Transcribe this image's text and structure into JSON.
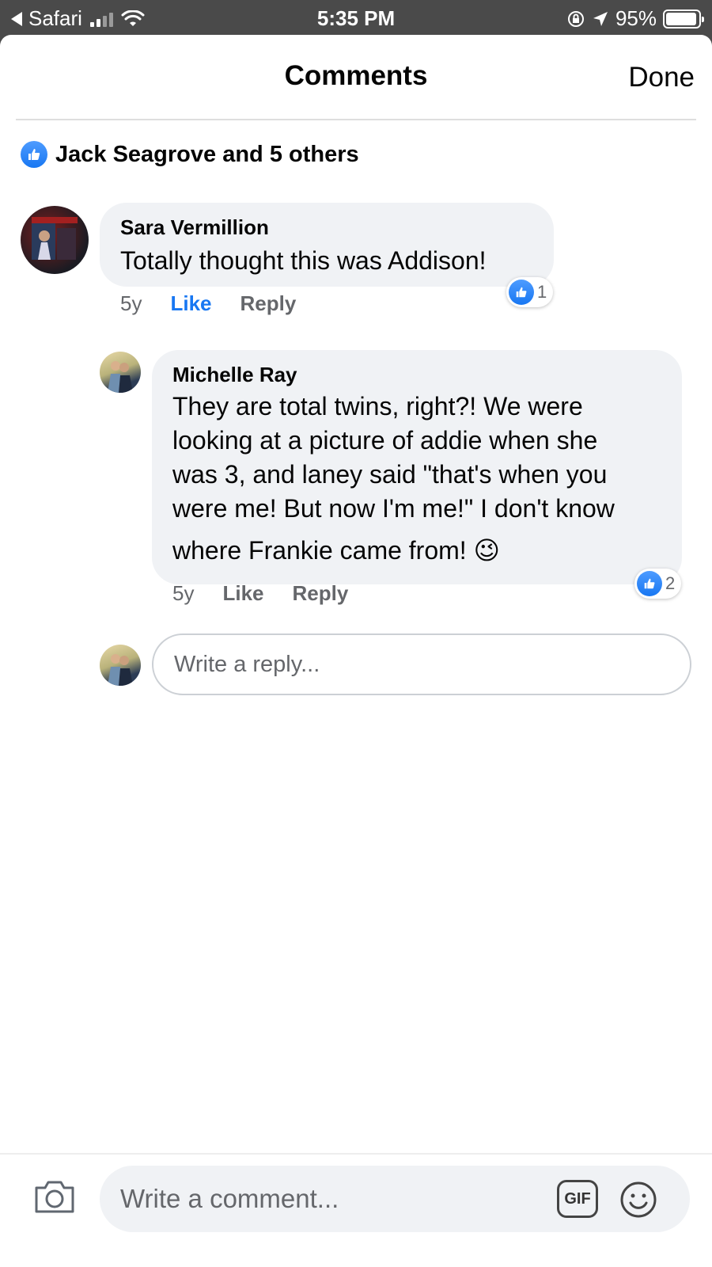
{
  "status_bar": {
    "back_app": "Safari",
    "time": "5:35 PM",
    "battery_percent": "95%",
    "battery_level": 0.95
  },
  "header": {
    "title": "Comments",
    "done_label": "Done"
  },
  "likes_summary": "Jack Seagrove and 5 others",
  "comments": [
    {
      "author": "Sara Vermillion",
      "text": "Totally thought this was Addison!",
      "age": "5y",
      "like_label": "Like",
      "reply_label": "Reply",
      "reaction_count": "1",
      "liked": true
    }
  ],
  "reply": {
    "author": "Michelle Ray",
    "lines": [
      "They are total twins, right?! We were",
      "looking at a picture of addie when she",
      "was 3, and laney said \"that's when you",
      "were me! But now I'm me!\" I don't know",
      "where Frankie came from! 😉"
    ],
    "age": "5y",
    "like_label": "Like",
    "reply_label": "Reply",
    "reaction_count": "2"
  },
  "reply_input": {
    "placeholder": "Write a reply..."
  },
  "composer": {
    "placeholder": "Write a comment...",
    "gif_label": "GIF"
  },
  "colors": {
    "accent": "#1877f2",
    "bubble": "#f0f2f5",
    "secondary_text": "#65676b"
  }
}
